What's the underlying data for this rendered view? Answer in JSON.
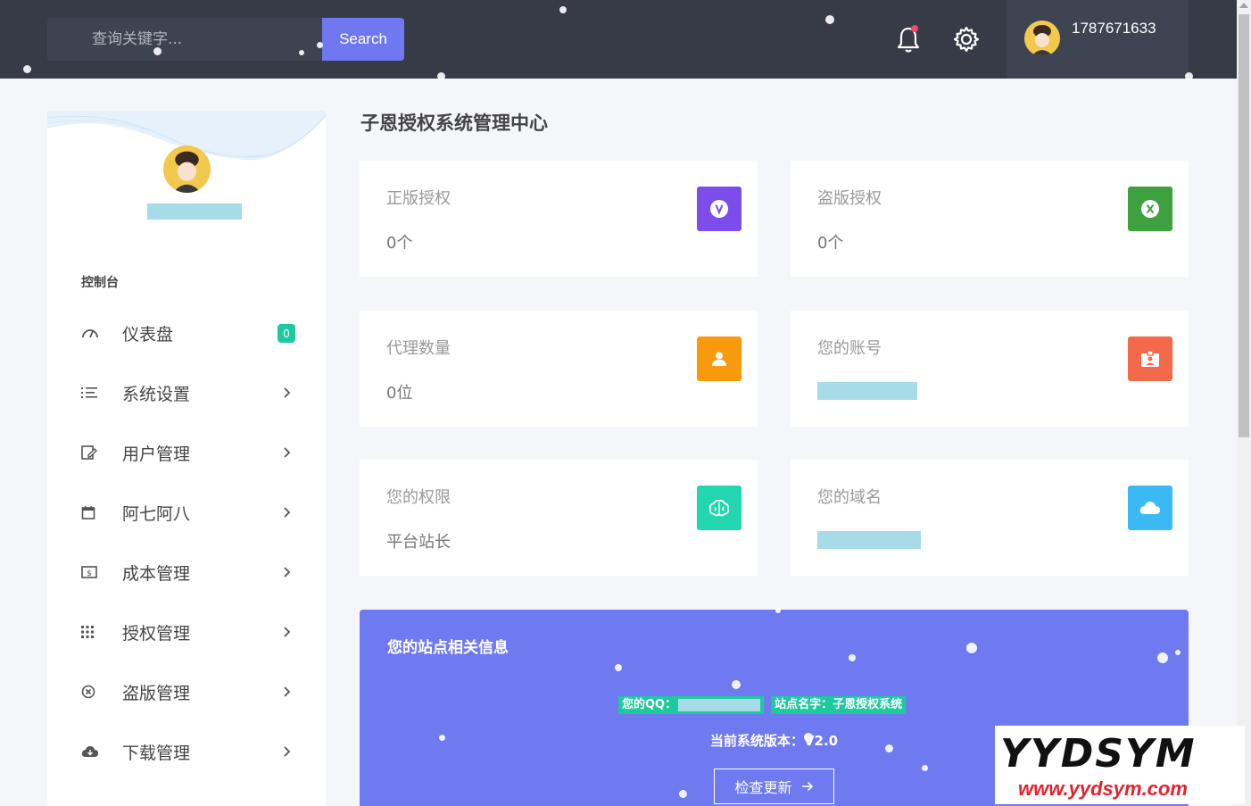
{
  "header": {
    "search_placeholder": "查询关键字...",
    "search_button": "Search",
    "username": "1787671633"
  },
  "sidebar": {
    "heading": "控制台",
    "items": [
      {
        "label": "仪表盘",
        "icon": "dashboard-icon",
        "badge": "0"
      },
      {
        "label": "系统设置",
        "icon": "list-icon"
      },
      {
        "label": "用户管理",
        "icon": "user-edit-icon"
      },
      {
        "label": "阿七阿八",
        "icon": "calendar-icon"
      },
      {
        "label": "成本管理",
        "icon": "money-icon"
      },
      {
        "label": "授权管理",
        "icon": "grid-icon"
      },
      {
        "label": "盗版管理",
        "icon": "close-circle-icon"
      },
      {
        "label": "下载管理",
        "icon": "cloud-download-icon"
      }
    ]
  },
  "main": {
    "title": "子恩授权系统管理中心",
    "cards": [
      {
        "label": "正版授权",
        "value": "0个",
        "color": "#7c4dea",
        "icon": "v-circle-icon"
      },
      {
        "label": "盗版授权",
        "value": "0个",
        "color": "#3fa040",
        "icon": "x-circle-icon"
      },
      {
        "label": "代理数量",
        "value": "0位",
        "color": "#f89a0c",
        "icon": "person-icon"
      },
      {
        "label": "您的账号",
        "value": "",
        "color": "#f4694a",
        "icon": "badge-icon"
      },
      {
        "label": "您的权限",
        "value": "平台站长",
        "color": "#22d7b0",
        "icon": "brain-icon"
      },
      {
        "label": "您的域名",
        "value": "",
        "color": "#3bb9f5",
        "icon": "cloud-icon"
      }
    ],
    "info": {
      "title": "您的站点相关信息",
      "qq_label": "您的QQ：",
      "site_name": "站点名字：子恩授权系统",
      "version": "当前系统版本：V2.0",
      "update_button": "检查更新"
    }
  },
  "watermark": {
    "top": "YYDSYM",
    "bottom": "www.yydsym.com"
  }
}
